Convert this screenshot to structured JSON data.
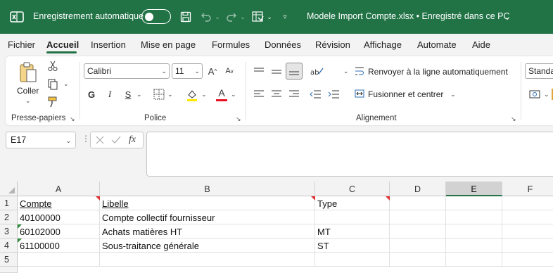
{
  "titlebar": {
    "autosave_label": "Enregistrement automatique",
    "filename": "Modele Import Compte.xlsx • Enregistré dans ce PC",
    "bg_color": "#217346"
  },
  "menu": {
    "tabs": [
      "Fichier",
      "Accueil",
      "Insertion",
      "Mise en page",
      "Formules",
      "Données",
      "Révision",
      "Affichage",
      "Automate",
      "Aide"
    ],
    "active_tab": "Accueil"
  },
  "ribbon": {
    "clipboard": {
      "paste_label": "Coller",
      "group_label": "Presse-papiers"
    },
    "font": {
      "font_name": "Calibri",
      "font_size": "11",
      "bold": "G",
      "italic": "I",
      "underline": "S",
      "group_label": "Police"
    },
    "alignment": {
      "wrap_label": "Renvoyer à la ligne automatiquement",
      "merge_label": "Fusionner et centrer",
      "group_label": "Alignement"
    },
    "number": {
      "format_value": "Standa"
    }
  },
  "formula_bar": {
    "name_box": "E17",
    "fx_label": "fx",
    "content": ""
  },
  "sheet": {
    "columns": [
      "A",
      "B",
      "C",
      "D",
      "E",
      "F"
    ],
    "selected_column": "E",
    "rows": [
      {
        "num": "1",
        "A": "Compte",
        "B": "Libelle",
        "C": "Type"
      },
      {
        "num": "2",
        "A": "40100000",
        "B": "Compte collectif fournisseur",
        "C": ""
      },
      {
        "num": "3",
        "A": "60102000",
        "B": "Achats matières HT",
        "C": "MT"
      },
      {
        "num": "4",
        "A": "61100000",
        "B": "Sous-traitance générale",
        "C": "ST"
      },
      {
        "num": "5",
        "A": "",
        "B": "",
        "C": ""
      }
    ]
  }
}
